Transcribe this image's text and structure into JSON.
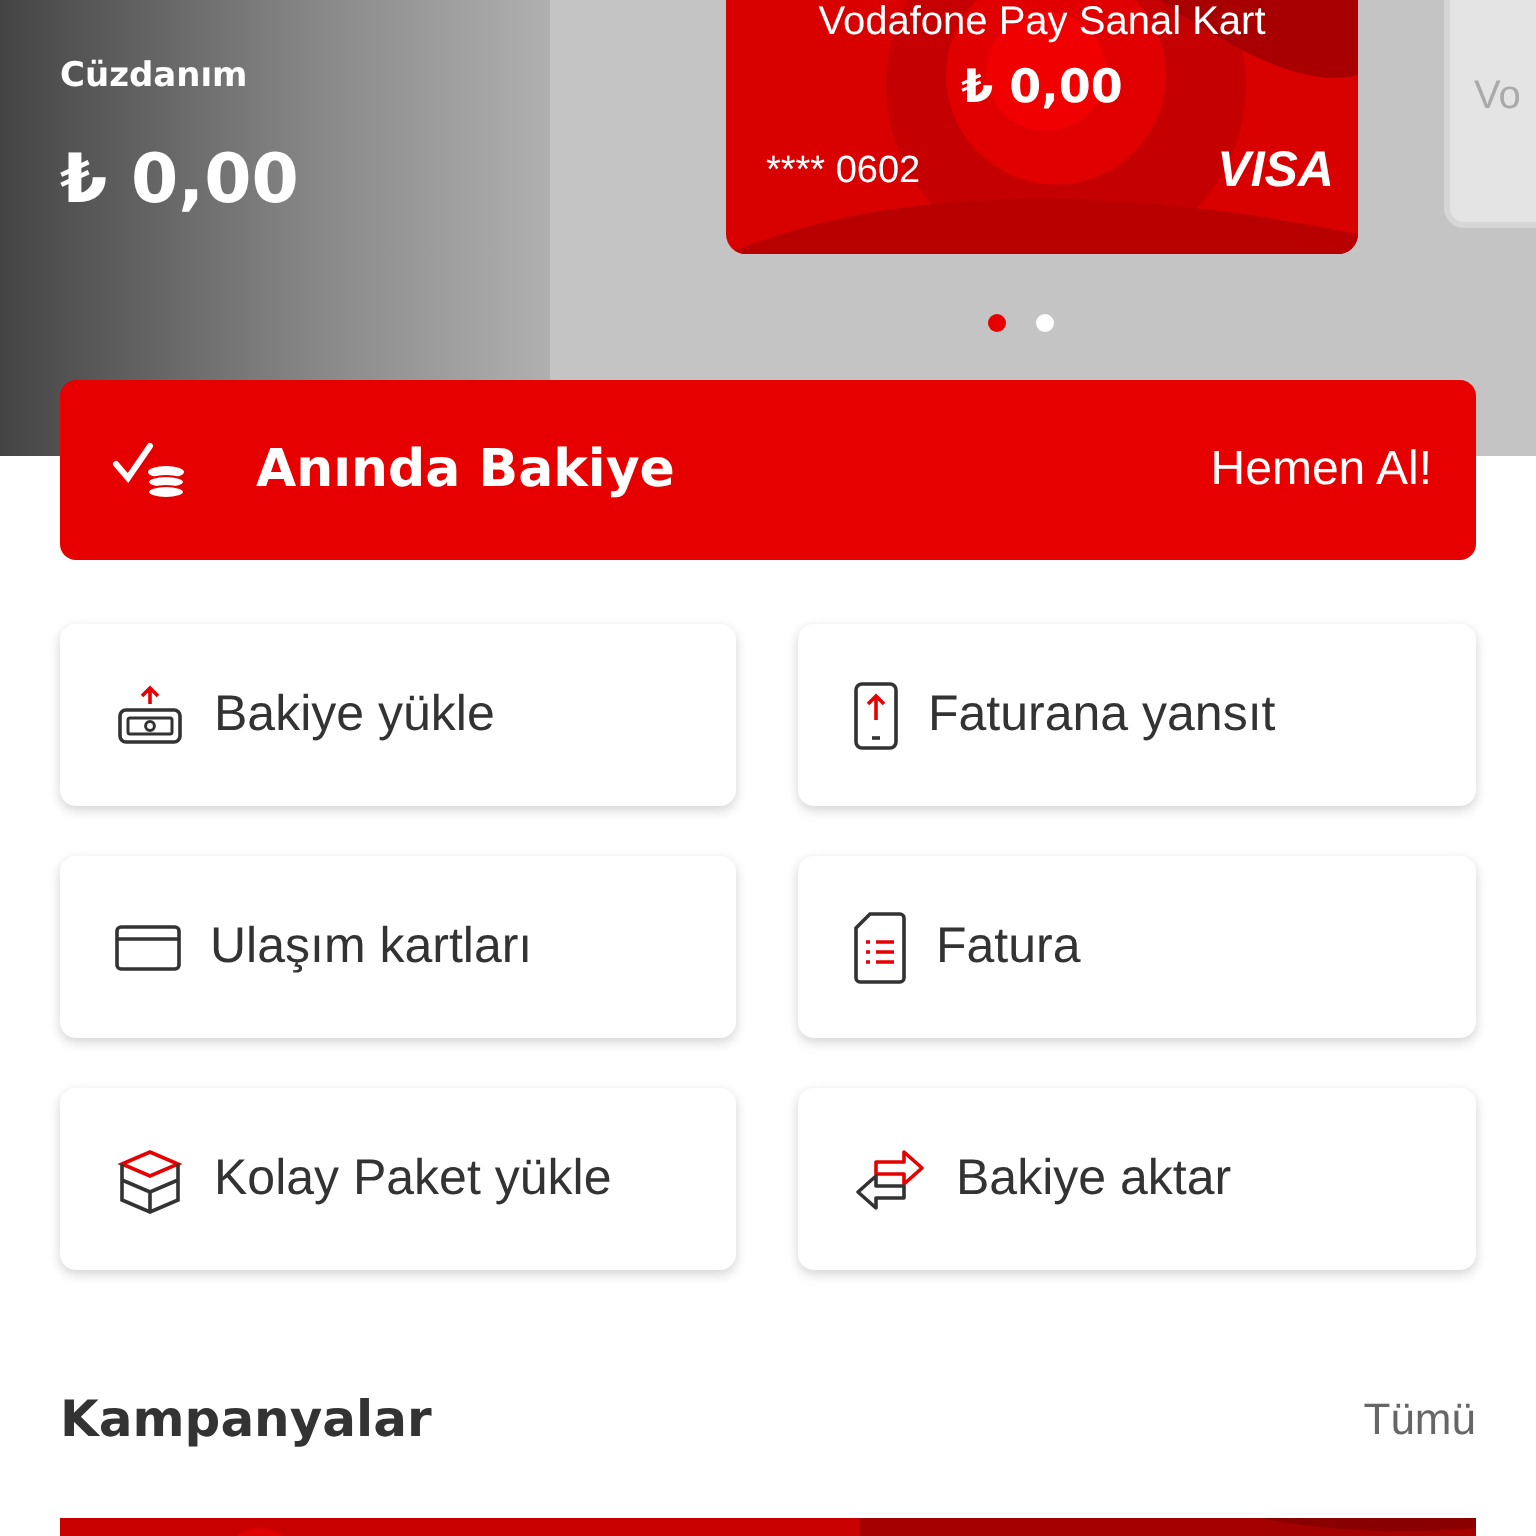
{
  "wallet": {
    "label": "Cüzdanım",
    "amount": "₺ 0,00"
  },
  "cards": [
    {
      "kind": "red",
      "title": "Vodafone Pay Sanal Kart",
      "balance": "₺ 0,00",
      "mask": "****",
      "number": "0602",
      "brand": "VISA"
    },
    {
      "kind": "grey",
      "title": "Vo"
    }
  ],
  "dots": [
    {
      "selected": true
    },
    {
      "selected": false
    }
  ],
  "banner": {
    "title": "Anında Bakiye",
    "action": "Hemen Al!"
  },
  "actions": [
    {
      "kind": "topup",
      "label": "Bakiye yükle"
    },
    {
      "kind": "phone",
      "label": "Faturana yansıt"
    },
    {
      "kind": "card",
      "label": "Ulaşım kartları"
    },
    {
      "kind": "bill",
      "label": "Fatura"
    },
    {
      "kind": "box",
      "label": "Kolay Paket yükle"
    },
    {
      "kind": "transfer",
      "label": "Bakiye aktar"
    }
  ],
  "campaigns": {
    "title": "Kampanyalar",
    "link": "Tümü"
  }
}
